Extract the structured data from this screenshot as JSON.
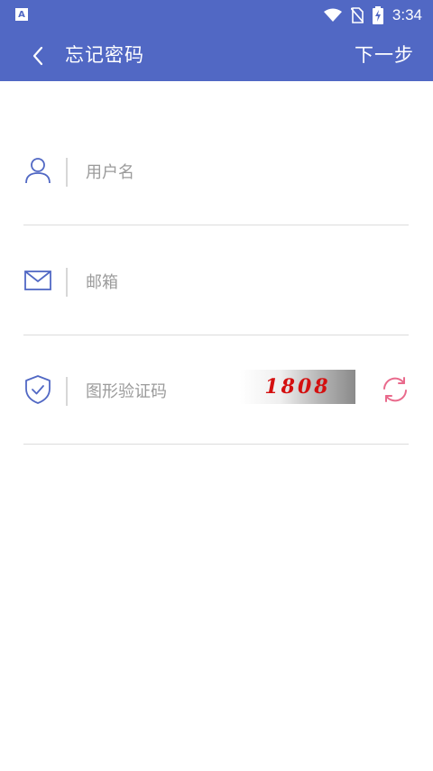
{
  "status_bar": {
    "time": "3:34",
    "left_badge": "A"
  },
  "app_bar": {
    "title": "忘记密码",
    "next_label": "下一步"
  },
  "form": {
    "username": {
      "placeholder": "用户名",
      "value": ""
    },
    "email": {
      "placeholder": "邮箱",
      "value": ""
    },
    "captcha": {
      "placeholder": "图形验证码",
      "value": "",
      "code": "1808"
    }
  },
  "colors": {
    "primary": "#5168c4",
    "refresh": "#e96a8c",
    "captcha_text": "#d40f0f"
  }
}
